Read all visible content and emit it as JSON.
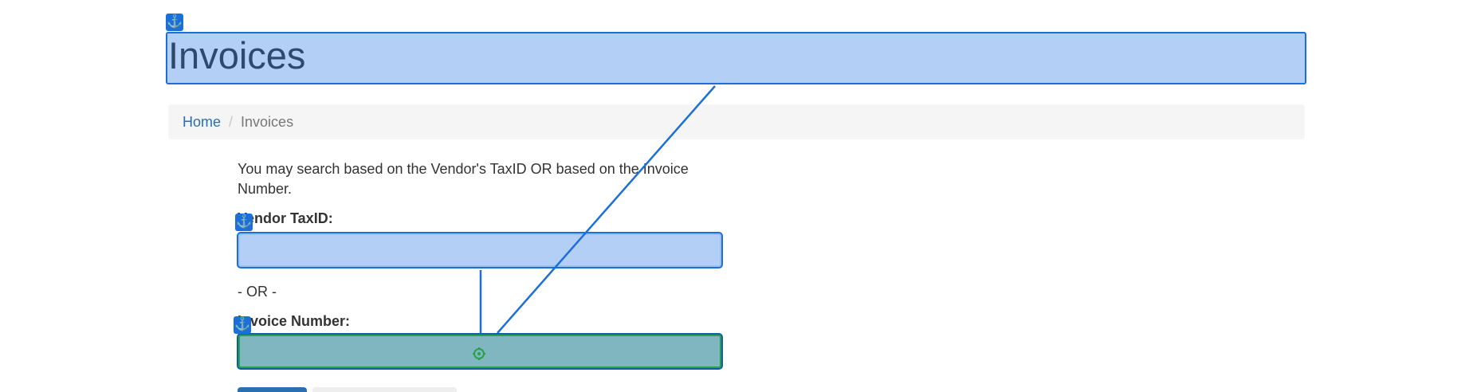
{
  "page": {
    "title": "Invoices"
  },
  "breadcrumb": {
    "home": "Home",
    "separator": "/",
    "current": "Invoices"
  },
  "search_form": {
    "intro": "You may search based on the Vendor's TaxID OR based on the Invoice Number.",
    "vendor_label": "Vendor TaxID:",
    "vendor_value": "",
    "or_text": "- OR -",
    "invoice_label": "Invoice Number:",
    "invoice_value": ""
  },
  "overlay": {
    "anchor_icon": "⚓",
    "target_icon": "crosshair-icon",
    "colors": {
      "highlight_fill": "#b3cff4",
      "highlight_border": "#1a6fd8",
      "target_fill": "#7fb6bf",
      "target_ring": "#27a24a"
    }
  },
  "colors": {
    "link": "#2a6fb0",
    "title": "#2b4a6e",
    "breadcrumb_bg": "#f5f5f5"
  }
}
